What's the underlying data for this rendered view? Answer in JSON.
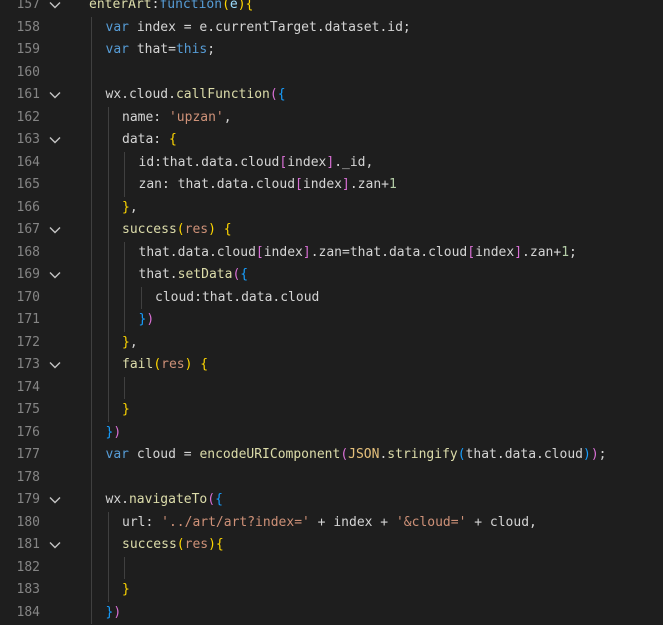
{
  "editor": {
    "fold_icon": "chevron-down-icon",
    "lines": [
      {
        "n": "157",
        "fold": true,
        "indent": 0,
        "tokens": [
          {
            "t": "enterArt",
            "c": "t-fnname"
          },
          {
            "t": ":",
            "c": "t-punc"
          },
          {
            "t": "function",
            "c": "t-kw"
          },
          {
            "t": "(",
            "c": "t-b1"
          },
          {
            "t": "e",
            "c": "t-param"
          },
          {
            "t": "){",
            "c": "t-b1"
          }
        ]
      },
      {
        "n": "158",
        "fold": false,
        "indent": 1,
        "tokens": [
          {
            "t": "var ",
            "c": "t-kw"
          },
          {
            "t": "index = e.currentTarget.dataset.id;",
            "c": "t-punc"
          }
        ]
      },
      {
        "n": "159",
        "fold": false,
        "indent": 1,
        "tokens": [
          {
            "t": "var ",
            "c": "t-kw"
          },
          {
            "t": "that=",
            "c": "t-punc"
          },
          {
            "t": "this",
            "c": "t-kw"
          },
          {
            "t": ";",
            "c": "t-punc"
          }
        ]
      },
      {
        "n": "160",
        "fold": false,
        "indent": 1,
        "tokens": []
      },
      {
        "n": "161",
        "fold": true,
        "indent": 1,
        "tokens": [
          {
            "t": "wx.cloud.",
            "c": "t-punc"
          },
          {
            "t": "callFunction",
            "c": "t-fn"
          },
          {
            "t": "(",
            "c": "t-b2"
          },
          {
            "t": "{",
            "c": "t-b3"
          }
        ]
      },
      {
        "n": "162",
        "fold": false,
        "indent": 2,
        "tokens": [
          {
            "t": "name: ",
            "c": "t-punc"
          },
          {
            "t": "'upzan'",
            "c": "t-str"
          },
          {
            "t": ",",
            "c": "t-punc"
          }
        ]
      },
      {
        "n": "163",
        "fold": true,
        "indent": 2,
        "tokens": [
          {
            "t": "data: ",
            "c": "t-punc"
          },
          {
            "t": "{",
            "c": "t-b1"
          }
        ]
      },
      {
        "n": "164",
        "fold": false,
        "indent": 3,
        "tokens": [
          {
            "t": "id:that.data.cloud",
            "c": "t-punc"
          },
          {
            "t": "[",
            "c": "t-b2"
          },
          {
            "t": "index",
            "c": "t-punc"
          },
          {
            "t": "]",
            "c": "t-b2"
          },
          {
            "t": "._id,",
            "c": "t-punc"
          }
        ]
      },
      {
        "n": "165",
        "fold": false,
        "indent": 3,
        "tokens": [
          {
            "t": "zan: that.data.cloud",
            "c": "t-punc"
          },
          {
            "t": "[",
            "c": "t-b2"
          },
          {
            "t": "index",
            "c": "t-punc"
          },
          {
            "t": "]",
            "c": "t-b2"
          },
          {
            "t": ".zan+",
            "c": "t-punc"
          },
          {
            "t": "1",
            "c": "t-num"
          }
        ]
      },
      {
        "n": "166",
        "fold": false,
        "indent": 2,
        "tokens": [
          {
            "t": "}",
            "c": "t-b1"
          },
          {
            "t": ",",
            "c": "t-punc"
          }
        ]
      },
      {
        "n": "167",
        "fold": true,
        "indent": 2,
        "tokens": [
          {
            "t": "success",
            "c": "t-fn"
          },
          {
            "t": "(",
            "c": "t-b1"
          },
          {
            "t": "res",
            "c": "t-str"
          },
          {
            "t": ")",
            "c": "t-b1"
          },
          {
            "t": " ",
            "c": "t-punc"
          },
          {
            "t": "{",
            "c": "t-b1"
          }
        ]
      },
      {
        "n": "168",
        "fold": false,
        "indent": 3,
        "tokens": [
          {
            "t": "that.data.cloud",
            "c": "t-punc"
          },
          {
            "t": "[",
            "c": "t-b2"
          },
          {
            "t": "index",
            "c": "t-punc"
          },
          {
            "t": "]",
            "c": "t-b2"
          },
          {
            "t": ".zan=that.data.cloud",
            "c": "t-punc"
          },
          {
            "t": "[",
            "c": "t-b2"
          },
          {
            "t": "index",
            "c": "t-punc"
          },
          {
            "t": "]",
            "c": "t-b2"
          },
          {
            "t": ".zan+",
            "c": "t-punc"
          },
          {
            "t": "1",
            "c": "t-num"
          },
          {
            "t": ";",
            "c": "t-punc"
          }
        ]
      },
      {
        "n": "169",
        "fold": true,
        "indent": 3,
        "tokens": [
          {
            "t": "that.",
            "c": "t-punc"
          },
          {
            "t": "setData",
            "c": "t-fn"
          },
          {
            "t": "(",
            "c": "t-b2"
          },
          {
            "t": "{",
            "c": "t-b3"
          }
        ]
      },
      {
        "n": "170",
        "fold": false,
        "indent": 4,
        "tokens": [
          {
            "t": "cloud:that.data.cloud",
            "c": "t-punc"
          }
        ]
      },
      {
        "n": "171",
        "fold": false,
        "indent": 3,
        "tokens": [
          {
            "t": "}",
            "c": "t-b3"
          },
          {
            "t": ")",
            "c": "t-b2"
          }
        ]
      },
      {
        "n": "172",
        "fold": false,
        "indent": 2,
        "tokens": [
          {
            "t": "}",
            "c": "t-b1"
          },
          {
            "t": ",",
            "c": "t-punc"
          }
        ]
      },
      {
        "n": "173",
        "fold": true,
        "indent": 2,
        "tokens": [
          {
            "t": "fail",
            "c": "t-fn"
          },
          {
            "t": "(",
            "c": "t-b1"
          },
          {
            "t": "res",
            "c": "t-str"
          },
          {
            "t": ")",
            "c": "t-b1"
          },
          {
            "t": " ",
            "c": "t-punc"
          },
          {
            "t": "{",
            "c": "t-b1"
          }
        ]
      },
      {
        "n": "174",
        "fold": false,
        "indent": 3,
        "tokens": []
      },
      {
        "n": "175",
        "fold": false,
        "indent": 2,
        "tokens": [
          {
            "t": "}",
            "c": "t-b1"
          }
        ]
      },
      {
        "n": "176",
        "fold": false,
        "indent": 1,
        "tokens": [
          {
            "t": "}",
            "c": "t-b3"
          },
          {
            "t": ")",
            "c": "t-b2"
          }
        ]
      },
      {
        "n": "177",
        "fold": false,
        "indent": 1,
        "tokens": [
          {
            "t": "var ",
            "c": "t-kw"
          },
          {
            "t": "cloud = ",
            "c": "t-punc"
          },
          {
            "t": "encodeURIComponent",
            "c": "t-fn"
          },
          {
            "t": "(",
            "c": "t-b2"
          },
          {
            "t": "JSON",
            "c": "t-gold"
          },
          {
            "t": ".",
            "c": "t-punc"
          },
          {
            "t": "stringify",
            "c": "t-fn"
          },
          {
            "t": "(",
            "c": "t-b3"
          },
          {
            "t": "that.data.cloud",
            "c": "t-punc"
          },
          {
            "t": ")",
            "c": "t-b3"
          },
          {
            "t": ")",
            "c": "t-b2"
          },
          {
            "t": ";",
            "c": "t-punc"
          }
        ]
      },
      {
        "n": "178",
        "fold": false,
        "indent": 1,
        "tokens": []
      },
      {
        "n": "179",
        "fold": true,
        "indent": 1,
        "tokens": [
          {
            "t": "wx.",
            "c": "t-punc"
          },
          {
            "t": "navigateTo",
            "c": "t-fn"
          },
          {
            "t": "(",
            "c": "t-b2"
          },
          {
            "t": "{",
            "c": "t-b3"
          }
        ]
      },
      {
        "n": "180",
        "fold": false,
        "indent": 2,
        "tokens": [
          {
            "t": "url: ",
            "c": "t-punc"
          },
          {
            "t": "'../art/art?index='",
            "c": "t-str"
          },
          {
            "t": " + index + ",
            "c": "t-punc"
          },
          {
            "t": "'&cloud='",
            "c": "t-str"
          },
          {
            "t": " + cloud,",
            "c": "t-punc"
          }
        ]
      },
      {
        "n": "181",
        "fold": true,
        "indent": 2,
        "tokens": [
          {
            "t": "success",
            "c": "t-fn"
          },
          {
            "t": "(",
            "c": "t-b1"
          },
          {
            "t": "res",
            "c": "t-str"
          },
          {
            "t": "){",
            "c": "t-b1"
          }
        ]
      },
      {
        "n": "182",
        "fold": false,
        "indent": 3,
        "tokens": []
      },
      {
        "n": "183",
        "fold": false,
        "indent": 2,
        "tokens": [
          {
            "t": "}",
            "c": "t-b1"
          }
        ]
      },
      {
        "n": "184",
        "fold": false,
        "indent": 1,
        "tokens": [
          {
            "t": "}",
            "c": "t-b3"
          },
          {
            "t": ")",
            "c": "t-b2"
          }
        ]
      }
    ]
  }
}
